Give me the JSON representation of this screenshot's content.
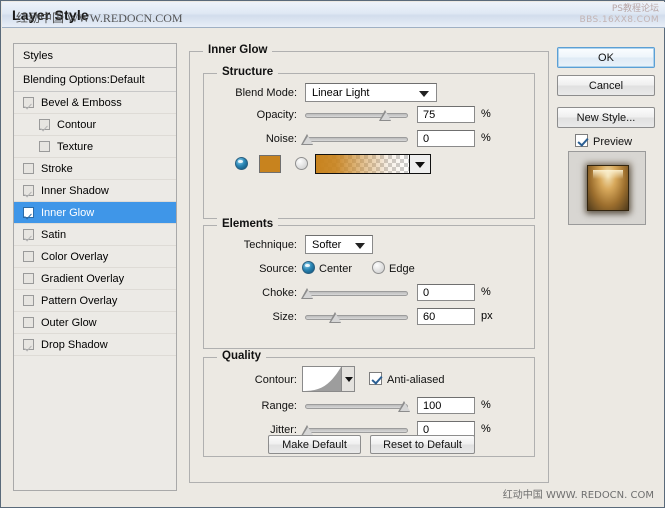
{
  "window": {
    "title": "Layer Style",
    "watermark_title": "红动中国 WWW.REDOCN.COM",
    "watermark_topright_line1": "PS教程论坛",
    "watermark_topright_line2": "BBS.16XX8.COM",
    "watermark_bottomright": "红动中国  WWW. REDOCN. COM"
  },
  "sidebar": {
    "header": "Styles",
    "blending_options": "Blending Options:Default",
    "items": [
      {
        "label": "Bevel & Emboss",
        "checked": true,
        "indent": false,
        "selected": false
      },
      {
        "label": "Contour",
        "checked": true,
        "indent": true,
        "selected": false
      },
      {
        "label": "Texture",
        "checked": false,
        "indent": true,
        "selected": false
      },
      {
        "label": "Stroke",
        "checked": false,
        "indent": false,
        "selected": false
      },
      {
        "label": "Inner Shadow",
        "checked": true,
        "indent": false,
        "selected": false
      },
      {
        "label": "Inner Glow",
        "checked": true,
        "indent": false,
        "selected": true
      },
      {
        "label": "Satin",
        "checked": true,
        "indent": false,
        "selected": false
      },
      {
        "label": "Color Overlay",
        "checked": false,
        "indent": false,
        "selected": false
      },
      {
        "label": "Gradient Overlay",
        "checked": false,
        "indent": false,
        "selected": false
      },
      {
        "label": "Pattern Overlay",
        "checked": false,
        "indent": false,
        "selected": false
      },
      {
        "label": "Outer Glow",
        "checked": false,
        "indent": false,
        "selected": false
      },
      {
        "label": "Drop Shadow",
        "checked": true,
        "indent": false,
        "selected": false
      }
    ]
  },
  "panel": {
    "title": "Inner Glow",
    "structure": {
      "title": "Structure",
      "blend_mode_label": "Blend Mode:",
      "blend_mode_value": "Linear Light",
      "opacity_label": "Opacity:",
      "opacity_value": "75",
      "opacity_unit": "%",
      "noise_label": "Noise:",
      "noise_value": "0",
      "noise_unit": "%",
      "color_mode_selected": "color",
      "color_swatch": "#c8831e",
      "gradient_start": "#c8831e"
    },
    "elements": {
      "title": "Elements",
      "technique_label": "Technique:",
      "technique_value": "Softer",
      "source_label": "Source:",
      "source_center": "Center",
      "source_edge": "Edge",
      "source_selected": "Center",
      "choke_label": "Choke:",
      "choke_value": "0",
      "choke_unit": "%",
      "size_label": "Size:",
      "size_value": "60",
      "size_unit": "px"
    },
    "quality": {
      "title": "Quality",
      "contour_label": "Contour:",
      "antialiased_label": "Anti-aliased",
      "antialiased_checked": true,
      "range_label": "Range:",
      "range_value": "100",
      "range_unit": "%",
      "jitter_label": "Jitter:",
      "jitter_value": "0",
      "jitter_unit": "%"
    },
    "make_default": "Make Default",
    "reset_to_default": "Reset to Default"
  },
  "actions": {
    "ok": "OK",
    "cancel": "Cancel",
    "new_style": "New Style...",
    "preview_label": "Preview",
    "preview_checked": true
  }
}
